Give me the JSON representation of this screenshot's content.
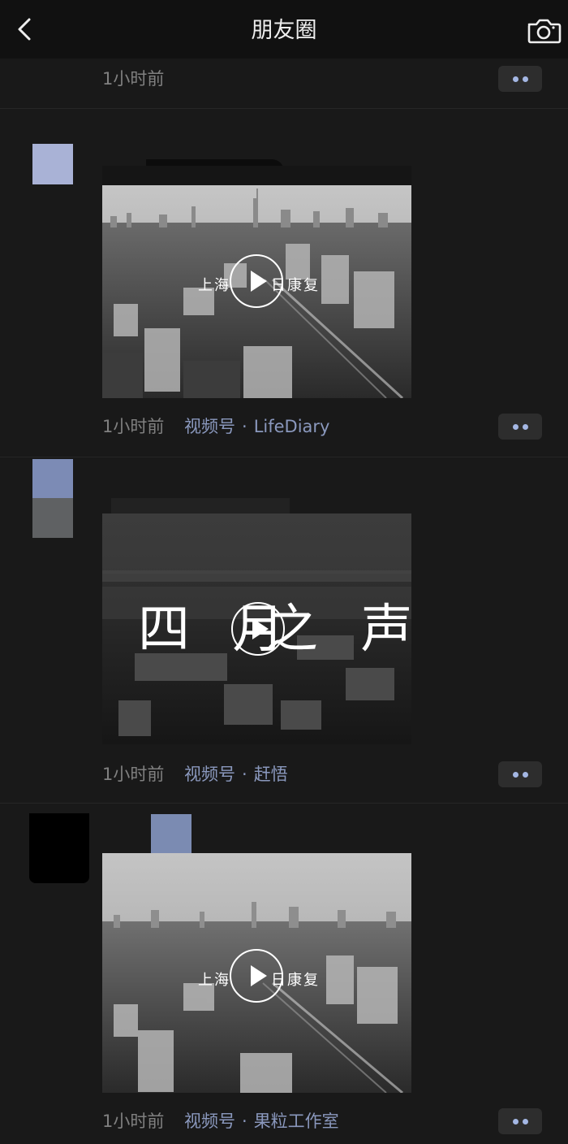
{
  "nav": {
    "title": "朋友圈",
    "back_icon": "chevron-left-icon",
    "camera_icon": "camera-icon"
  },
  "colors": {
    "background": "#191919",
    "nav_background": "#111111",
    "link": "#8a98bd",
    "time": "#808080",
    "more_dots": "#a4b7e4"
  },
  "posts": [
    {
      "time": "1小时前",
      "source": null
    },
    {
      "time": "1小时前",
      "source_prefix": "视频号",
      "source_sep": "·",
      "source_name": "LifeDiary",
      "overlay": {
        "left": "上海",
        "right": "日康复"
      }
    },
    {
      "time": "1小时前",
      "source_prefix": "视频号",
      "source_sep": "·",
      "source_name": "赶悟",
      "overlay": {
        "left": "四 月",
        "right": "之 声"
      }
    },
    {
      "time": "1小时前",
      "source_prefix": "视频号",
      "source_sep": "·",
      "source_name": "果粒工作室",
      "overlay": {
        "left": "上海",
        "right": "日康复"
      }
    }
  ]
}
